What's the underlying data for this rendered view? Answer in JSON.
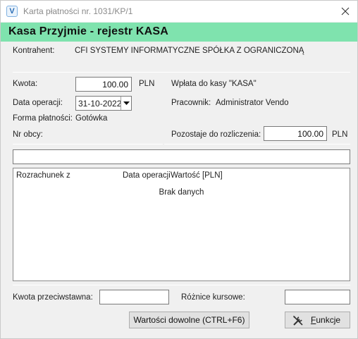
{
  "window": {
    "title": "Karta płatności nr. 1031/KP/1",
    "icon_letter": "V",
    "close_icon": "close-icon"
  },
  "banner": {
    "text": "Kasa Przyjmie - rejestr KASA",
    "color": "#7fe3ae"
  },
  "contractor": {
    "label": "Kontrahent:",
    "value": "CFI SYSTEMY INFORMATYCZNE SPÓŁKA Z OGRANICZONĄ"
  },
  "amount": {
    "label": "Kwota:",
    "value": "100.00",
    "currency": "PLN"
  },
  "deposit": {
    "text": "Wpłata do kasy  \"KASA\""
  },
  "operation_date": {
    "label": "Data operacji:",
    "value": "31-10-2022"
  },
  "employee": {
    "label": "Pracownik:",
    "value": "Administrator Vendo"
  },
  "payment_form": {
    "label": "Forma płatności:",
    "value": "Gotówka"
  },
  "foreign_no": {
    "label": "Nr obcy:"
  },
  "remaining": {
    "label": "Pozostaje do rozliczenia:",
    "value": "100.00",
    "currency": "PLN"
  },
  "note_field": {
    "value": ""
  },
  "settlements_table": {
    "columns": [
      "Rozrachunek z",
      "Data operacji",
      "Wartość [PLN]"
    ],
    "empty_text": "Brak danych"
  },
  "counter_amount": {
    "label": "Kwota przeciwstawna:",
    "value": ""
  },
  "fx_diff": {
    "label": "Różnice kursowe:",
    "value": ""
  },
  "buttons": {
    "arbitrary_values": "Wartości dowolne (CTRL+F6)",
    "functions_first": "F",
    "functions_rest": "unkcje"
  }
}
